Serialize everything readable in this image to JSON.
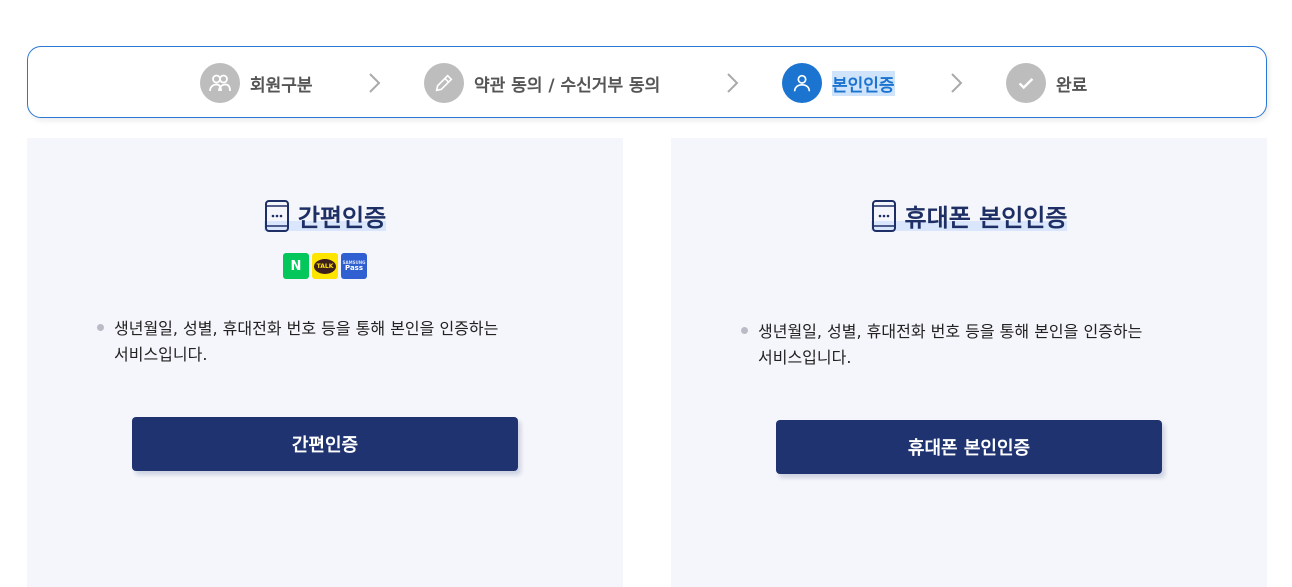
{
  "stepper": {
    "steps": [
      {
        "label": "회원구분",
        "icon": "users-icon",
        "state": "done"
      },
      {
        "label": "약관 동의 / 수신거부 동의",
        "icon": "pencil-icon",
        "state": "done"
      },
      {
        "label": "본인인증",
        "icon": "user-icon",
        "state": "active"
      },
      {
        "label": "완료",
        "icon": "check-icon",
        "state": "pending"
      }
    ]
  },
  "panels": {
    "simple": {
      "title": "간편인증",
      "badges": [
        "N",
        "TALK",
        "Pass"
      ],
      "description": "생년월일, 성별, 휴대전화 번호 등을 통해 본인을 인증하는 서비스입니다.",
      "description_line1": "생년월일, 성별, 휴대전화 번호 등을 통해 본인을 인증하는",
      "description_line2": "서비스입니다.",
      "button": "간편인증"
    },
    "phone": {
      "title": "휴대폰 본인인증",
      "description_line1": "생년월일, 성별, 휴대전화 번호 등을 통해 본인을 인증하는",
      "description_line2": "서비스입니다.",
      "button": "휴대폰 본인인증"
    }
  },
  "colors": {
    "accent": "#1b74d0",
    "button": "#1f3370",
    "panel_bg": "#f5f6fb",
    "naver": "#03c75a",
    "kakao": "#fee500",
    "pass": "#2f5fd0"
  }
}
